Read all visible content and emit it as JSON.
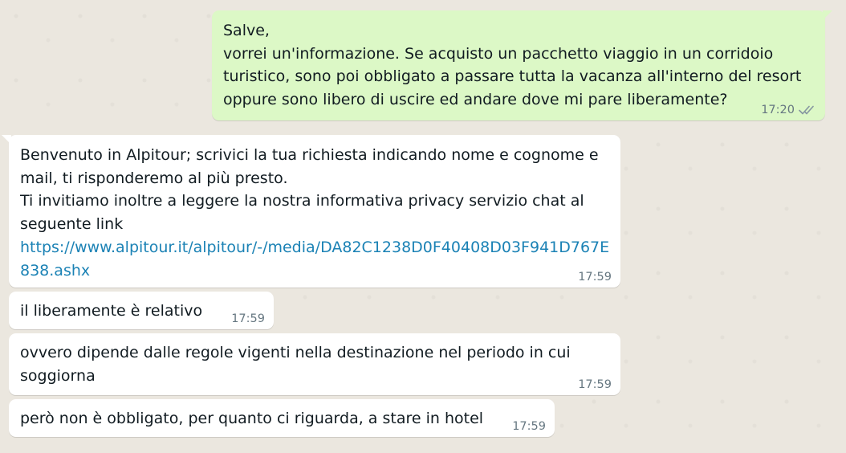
{
  "messages": [
    {
      "direction": "out",
      "lines": [
        "Salve,",
        "vorrei un'informazione. Se acquisto un pacchetto viaggio in un corridoio",
        "turistico, sono poi obbligato a passare tutta la vacanza all'interno del resort",
        "oppure sono libero di uscire ed andare dove mi pare liberamente?"
      ],
      "time": "17:20",
      "status_icon": "double-check-icon"
    },
    {
      "direction": "in",
      "lines": [
        "Benvenuto in Alpitour; scrivici la tua richiesta indicando nome e cognome e",
        "mail, ti risponderemo al più presto.",
        "Ti invitiamo inoltre a leggere la nostra informativa privacy servizio chat al",
        "seguente link"
      ],
      "link_lines": [
        "https://www.alpitour.it/alpitour/-/media/DA82C1238D0F40408D03F941D767E",
        "838.ashx"
      ],
      "time": "17:59"
    },
    {
      "direction": "in",
      "lines": [
        "il liberamente è relativo"
      ],
      "time": "17:59"
    },
    {
      "direction": "in",
      "lines": [
        "ovvero dipende dalle regole vigenti nella destinazione nel periodo in cui",
        "soggiorna"
      ],
      "time": "17:59"
    },
    {
      "direction": "in",
      "lines": [
        "però non è obbligato, per quanto ci riguarda, a stare in hotel"
      ],
      "time": "17:59"
    }
  ],
  "colors": {
    "background": "#ebe7df",
    "outgoing_bubble": "#dcf8c6",
    "incoming_bubble": "#ffffff",
    "link": "#1b82b5",
    "timestamp": "#667781",
    "read_ticks": "#8696a0"
  }
}
